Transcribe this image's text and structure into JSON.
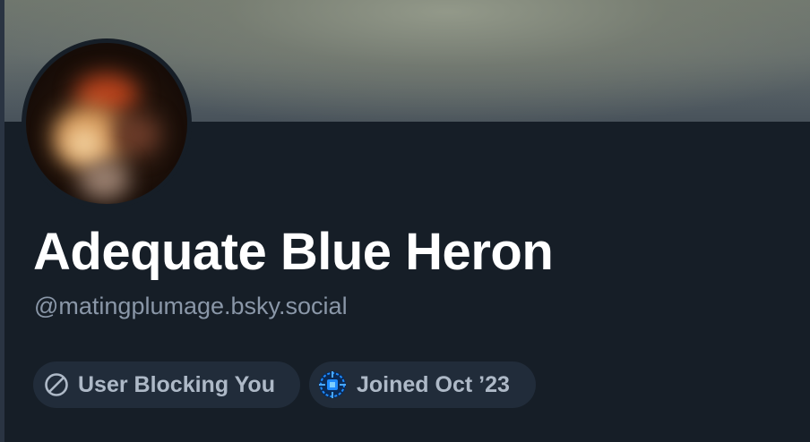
{
  "profile": {
    "display_name": "Adequate Blue Heron",
    "handle": "@matingplumage.bsky.social"
  },
  "badges": {
    "blocking_label": "User Blocking You",
    "joined_label": "Joined Oct ’23"
  },
  "icons": {
    "blocking": "block-icon",
    "joined": "starter-pack-icon"
  },
  "colors": {
    "background": "#161e27",
    "pill_background": "#212c3a",
    "pill_text": "#aeb9c7",
    "handle_text": "#8a97a8",
    "name_text": "#ffffff",
    "joined_icon_accent": "#1e8bff"
  }
}
